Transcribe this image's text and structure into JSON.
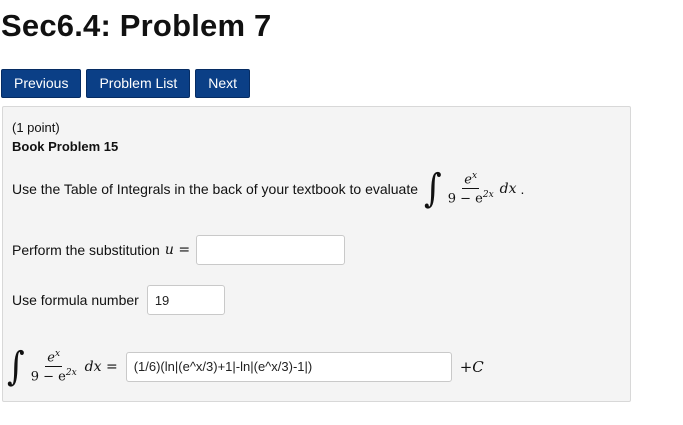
{
  "header": {
    "title": "Sec6.4: Problem 7"
  },
  "nav": {
    "previous_label": "Previous",
    "problem_list_label": "Problem List",
    "next_label": "Next"
  },
  "problem": {
    "points": "(1 point)",
    "book_problem": "Book Problem 15",
    "instruction": "Use the Table of Integrals in the back of your textbook to evaluate",
    "integral_symbol": "∫",
    "integrand_numerator": "e",
    "integrand_numerator_exp": "x",
    "integrand_denominator_base": "9 − e",
    "integrand_denominator_exp": "2x",
    "differential": "dx",
    "period": ".",
    "substitution_label": "Perform the substitution",
    "substitution_var": "u =",
    "substitution_value": "",
    "formula_label": "Use formula number",
    "formula_value": "19",
    "result_equals": "dx =",
    "answer_value": "(1/6)(ln|(e^x/3)+1|-ln|(e^x/3)-1|)",
    "constant": "+C"
  }
}
